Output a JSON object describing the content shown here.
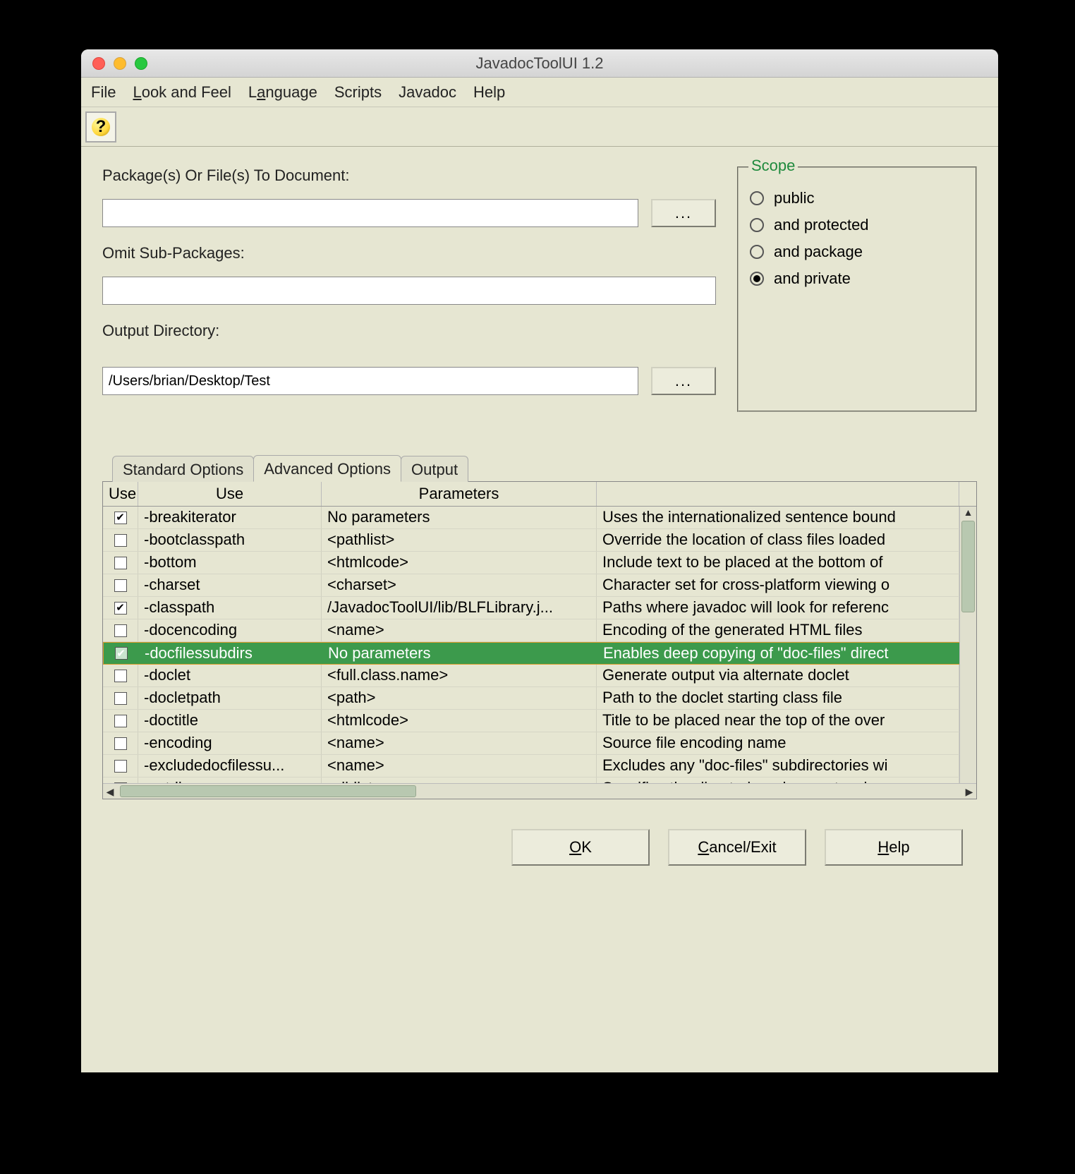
{
  "window": {
    "title": "JavadocToolUI 1.2"
  },
  "menu": {
    "file": "File",
    "look_and_feel": "Look and Feel",
    "language": "Language",
    "scripts": "Scripts",
    "javadoc": "Javadoc",
    "help": "Help"
  },
  "labels": {
    "packages": "Package(s) Or File(s) To Document:",
    "omit": "Omit Sub-Packages:",
    "output_dir": "Output Directory:",
    "browse": "...",
    "scope": "Scope"
  },
  "fields": {
    "packages": "",
    "omit": "",
    "output_dir": "/Users/brian/Desktop/Test"
  },
  "scope": {
    "options": [
      "public",
      "and protected",
      "and package",
      "and private"
    ],
    "selected": "and private"
  },
  "tabs": {
    "items": [
      "Standard Options",
      "Advanced Options",
      "Output"
    ],
    "active": "Advanced Options"
  },
  "table": {
    "headers": [
      "Use",
      "Use",
      "Parameters",
      ""
    ],
    "selected_row": 6,
    "rows": [
      {
        "checked": true,
        "opt": "-breakiterator",
        "param": "No parameters",
        "desc": "Uses the internationalized sentence bound"
      },
      {
        "checked": false,
        "opt": "-bootclasspath",
        "param": "<pathlist>",
        "desc": "Override the location of class files loaded"
      },
      {
        "checked": false,
        "opt": "-bottom",
        "param": "<htmlcode>",
        "desc": "Include text to be placed at the bottom of"
      },
      {
        "checked": false,
        "opt": "-charset",
        "param": "<charset>",
        "desc": "Character set for cross-platform viewing o"
      },
      {
        "checked": true,
        "opt": "-classpath",
        "param": "/JavadocToolUI/lib/BLFLibrary.j...",
        "desc": "Paths where javadoc will look for referenc"
      },
      {
        "checked": false,
        "opt": "-docencoding",
        "param": "<name>",
        "desc": "Encoding of the generated HTML files"
      },
      {
        "checked": true,
        "opt": "-docfilessubdirs",
        "param": "No parameters",
        "desc": "Enables deep copying of \"doc-files\" direct"
      },
      {
        "checked": false,
        "opt": "-doclet",
        "param": "<full.class.name>",
        "desc": "Generate output via alternate doclet"
      },
      {
        "checked": false,
        "opt": "-docletpath",
        "param": "<path>",
        "desc": "Path to the doclet starting class file"
      },
      {
        "checked": false,
        "opt": "-doctitle",
        "param": "<htmlcode>",
        "desc": "Title to be placed near the top of the over"
      },
      {
        "checked": false,
        "opt": "-encoding",
        "param": "<name>",
        "desc": "Source file encoding name"
      },
      {
        "checked": false,
        "opt": "-excludedocfilessu...",
        "param": "<name>",
        "desc": "Excludes any \"doc-files\" subdirectories wi"
      },
      {
        "checked": false,
        "opt": "-extdirs",
        "param": "<dirlist>",
        "desc": "Specifies the directories where extension"
      }
    ]
  },
  "buttons": {
    "ok": "OK",
    "cancel": "Cancel/Exit",
    "help": "Help"
  }
}
